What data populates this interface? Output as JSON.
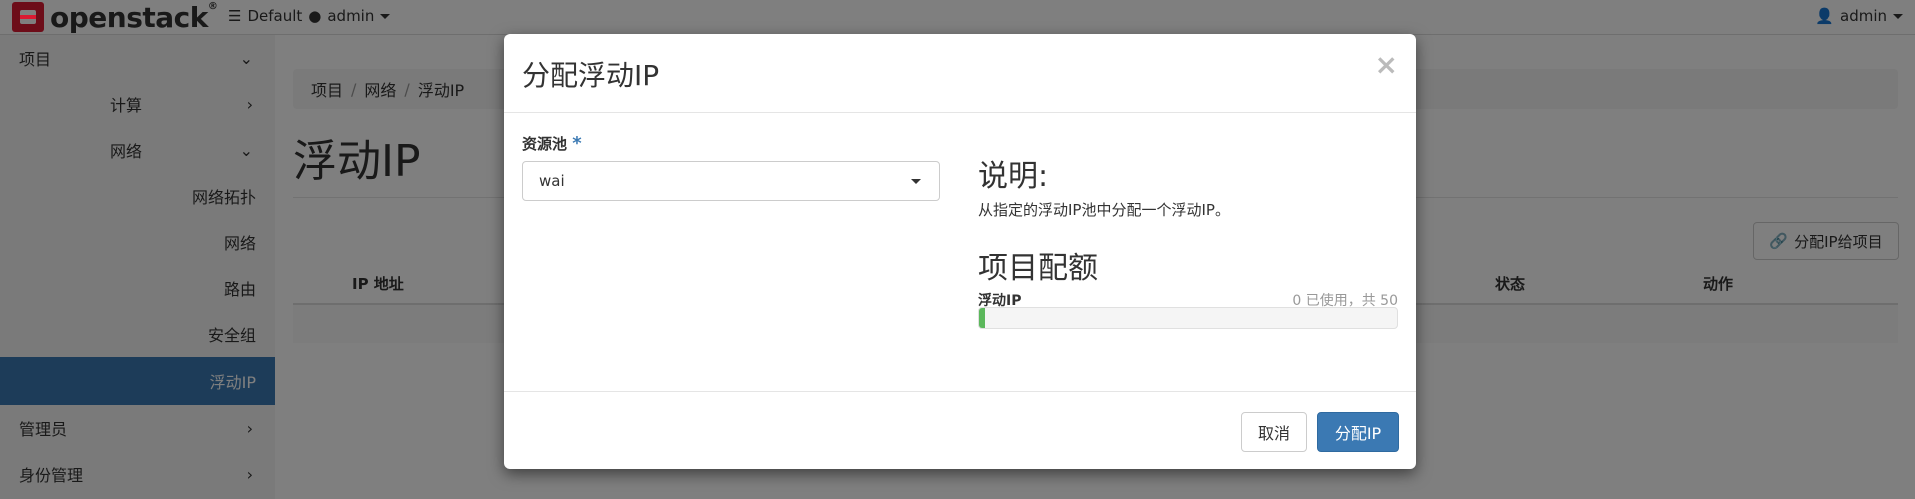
{
  "topbar": {
    "logo_text": "openstack",
    "logo_reg": "®",
    "domain": "Default",
    "project": "admin",
    "user": "admin"
  },
  "sidebar": {
    "items": [
      {
        "label": "项目"
      },
      {
        "label": "计算"
      },
      {
        "label": "网络"
      },
      {
        "label": "网络拓扑"
      },
      {
        "label": "网络"
      },
      {
        "label": "路由"
      },
      {
        "label": "安全组"
      },
      {
        "label": "浮动IP"
      },
      {
        "label": "管理员"
      },
      {
        "label": "身份管理"
      }
    ]
  },
  "breadcrumb": [
    "项目",
    "网络",
    "浮动IP"
  ],
  "page": {
    "title": "浮动IP",
    "action_button": "分配IP给项目",
    "table_headers": [
      "IP 地址",
      "状态",
      "动作"
    ]
  },
  "modal": {
    "title": "分配浮动IP",
    "close": "×",
    "field_label": "资源池",
    "required_mark": "*",
    "pool_value": "wai",
    "help_heading": "说明:",
    "help_text": "从指定的浮动IP池中分配一个浮动IP。",
    "quota_heading": "项目配额",
    "quota_label": "浮动IP",
    "quota_used_text": "0 已使用，共 50",
    "quota_used_fraction": 0.0,
    "cancel": "取消",
    "submit": "分配IP"
  },
  "colors": {
    "brand_red": "#da1a32",
    "primary": "#3b79b3",
    "progress": "#5cb85c"
  }
}
